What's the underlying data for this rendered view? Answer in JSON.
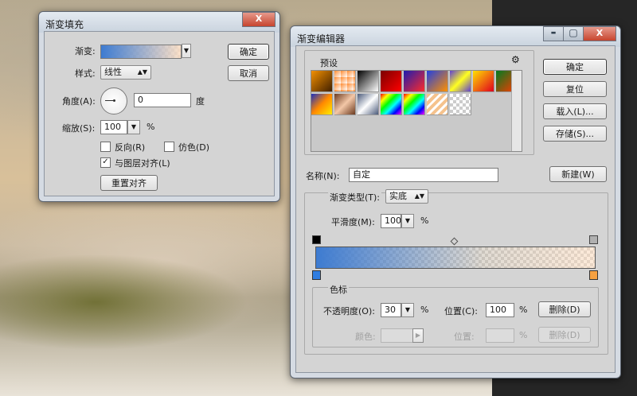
{
  "fill_dialog": {
    "title": "渐变填充",
    "gradient_label": "渐变:",
    "style_label": "样式:",
    "style_value": "线性",
    "angle_label": "角度(A):",
    "angle_value": "0",
    "angle_unit": "度",
    "scale_label": "缩放(S):",
    "scale_value": "100",
    "scale_unit": "%",
    "reverse_label": "反向(R)",
    "dither_label": "仿色(D)",
    "align_label": "与图层对齐(L)",
    "align_checked": true,
    "reset_align_button": "重置对齐",
    "ok_button": "确定",
    "cancel_button": "取消",
    "close_glyph": "X"
  },
  "editor": {
    "title": "渐变编辑器",
    "presets_label": "预设",
    "gear_glyph": "⚙",
    "ok_button": "确定",
    "reset_button": "复位",
    "load_button": "载入(L)...",
    "save_button": "存储(S)...",
    "name_label": "名称(N):",
    "name_value": "自定",
    "new_button": "新建(W)",
    "gradient_type_label": "渐变类型(T):",
    "gradient_type_value": "实底",
    "smoothness_label": "平滑度(M):",
    "smoothness_value": "100",
    "smoothness_unit": "%",
    "stops_group_label": "色标",
    "opacity_label": "不透明度(O):",
    "opacity_value": "30",
    "opacity_unit": "%",
    "location_label": "位置(C):",
    "location_value": "100",
    "location_unit": "%",
    "delete_button": "删除(D)",
    "color_label": "颜色:",
    "location2_label": "位置:",
    "location2_unit": "%",
    "delete2_button": "删除(D)",
    "min_glyph": "▬",
    "max_glyph": "▢",
    "close_glyph": "X"
  },
  "colors": {
    "gradient_start": "#3d7bd1",
    "gradient_end": "#fbdcc0"
  }
}
